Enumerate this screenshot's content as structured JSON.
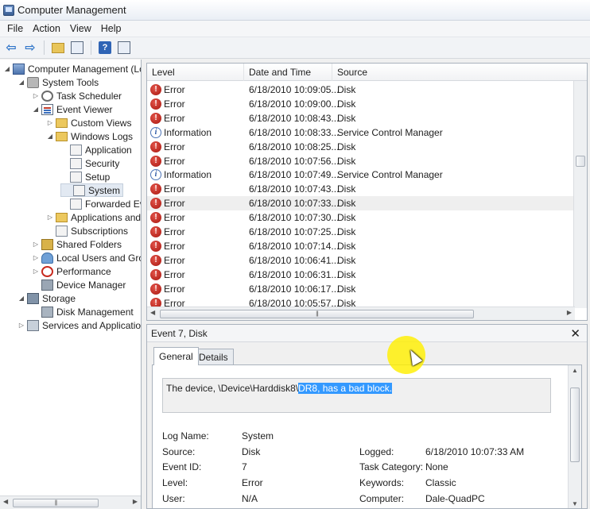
{
  "window": {
    "title": "Computer Management"
  },
  "menu": [
    "File",
    "Action",
    "View",
    "Help"
  ],
  "tree": {
    "items": [
      {
        "label": "Computer Management (Local",
        "indent": 0,
        "twisty": "◢",
        "icon": "computer-icon"
      },
      {
        "label": "System Tools",
        "indent": 1,
        "twisty": "◢",
        "icon": "tools-icon"
      },
      {
        "label": "Task Scheduler",
        "indent": 2,
        "twisty": "▷",
        "icon": "clock-icon"
      },
      {
        "label": "Event Viewer",
        "indent": 2,
        "twisty": "◢",
        "icon": "event-viewer-icon"
      },
      {
        "label": "Custom Views",
        "indent": 3,
        "twisty": "▷",
        "icon": "folder-icon"
      },
      {
        "label": "Windows Logs",
        "indent": 3,
        "twisty": "◢",
        "icon": "folder-icon"
      },
      {
        "label": "Application",
        "indent": 4,
        "twisty": "",
        "icon": "log-icon"
      },
      {
        "label": "Security",
        "indent": 4,
        "twisty": "",
        "icon": "log-icon"
      },
      {
        "label": "Setup",
        "indent": 4,
        "twisty": "",
        "icon": "log-icon"
      },
      {
        "label": "System",
        "indent": 4,
        "twisty": "",
        "icon": "log-icon"
      },
      {
        "label": "Forwarded Event",
        "indent": 4,
        "twisty": "",
        "icon": "log-icon"
      },
      {
        "label": "Applications and Se",
        "indent": 3,
        "twisty": "▷",
        "icon": "folder-icon"
      },
      {
        "label": "Subscriptions",
        "indent": 3,
        "twisty": "",
        "icon": "log-icon"
      },
      {
        "label": "Shared Folders",
        "indent": 2,
        "twisty": "▷",
        "icon": "shared-folder-icon"
      },
      {
        "label": "Local Users and Groups",
        "indent": 2,
        "twisty": "▷",
        "icon": "users-icon"
      },
      {
        "label": "Performance",
        "indent": 2,
        "twisty": "▷",
        "icon": "performance-icon"
      },
      {
        "label": "Device Manager",
        "indent": 2,
        "twisty": "",
        "icon": "device-manager-icon"
      },
      {
        "label": "Storage",
        "indent": 1,
        "twisty": "◢",
        "icon": "storage-icon"
      },
      {
        "label": "Disk Management",
        "indent": 2,
        "twisty": "",
        "icon": "disk-icon"
      },
      {
        "label": "Services and Applications",
        "indent": 1,
        "twisty": "▷",
        "icon": "services-icon"
      }
    ],
    "selected_item": "System"
  },
  "event_list": {
    "columns": [
      "Level",
      "Date and Time",
      "Source"
    ],
    "rows": [
      {
        "level": "Error",
        "datetime": "6/18/2010 10:09:05...",
        "source": "Disk"
      },
      {
        "level": "Error",
        "datetime": "6/18/2010 10:09:00...",
        "source": "Disk"
      },
      {
        "level": "Error",
        "datetime": "6/18/2010 10:08:43...",
        "source": "Disk"
      },
      {
        "level": "Information",
        "datetime": "6/18/2010 10:08:33...",
        "source": "Service Control Manager"
      },
      {
        "level": "Error",
        "datetime": "6/18/2010 10:08:25...",
        "source": "Disk"
      },
      {
        "level": "Error",
        "datetime": "6/18/2010 10:07:56...",
        "source": "Disk"
      },
      {
        "level": "Information",
        "datetime": "6/18/2010 10:07:49...",
        "source": "Service Control Manager"
      },
      {
        "level": "Error",
        "datetime": "6/18/2010 10:07:43...",
        "source": "Disk"
      },
      {
        "level": "Error",
        "datetime": "6/18/2010 10:07:33...",
        "source": "Disk"
      },
      {
        "level": "Error",
        "datetime": "6/18/2010 10:07:30...",
        "source": "Disk"
      },
      {
        "level": "Error",
        "datetime": "6/18/2010 10:07:25...",
        "source": "Disk"
      },
      {
        "level": "Error",
        "datetime": "6/18/2010 10:07:14...",
        "source": "Disk"
      },
      {
        "level": "Error",
        "datetime": "6/18/2010 10:06:41...",
        "source": "Disk"
      },
      {
        "level": "Error",
        "datetime": "6/18/2010 10:06:31...",
        "source": "Disk"
      },
      {
        "level": "Error",
        "datetime": "6/18/2010 10:06:17...",
        "source": "Disk"
      },
      {
        "level": "Error",
        "datetime": "6/18/2010 10:05:57...",
        "source": "Disk"
      }
    ],
    "selected_row_index": 8
  },
  "detail": {
    "title": "Event 7, Disk",
    "tabs": [
      "General",
      "Details"
    ],
    "active_tab": "General",
    "description_plain": "The device, \\Device\\Harddisk8\\",
    "description_selected": "DR8, has a bad block.",
    "properties": {
      "log_name_label": "Log Name:",
      "log_name": "System",
      "source_label": "Source:",
      "source": "Disk",
      "event_id_label": "Event ID:",
      "event_id": "7",
      "level_label": "Level:",
      "level": "Error",
      "user_label": "User:",
      "user": "N/A",
      "logged_label": "Logged:",
      "logged": "6/18/2010 10:07:33 AM",
      "task_category_label": "Task Category:",
      "task_category": "None",
      "keywords_label": "Keywords:",
      "keywords": "Classic",
      "computer_label": "Computer:",
      "computer": "Dale-QuadPC"
    }
  },
  "colors": {
    "selection": "#3399ff",
    "error": "#c0241b",
    "cursor_highlight": "#ffef00"
  }
}
